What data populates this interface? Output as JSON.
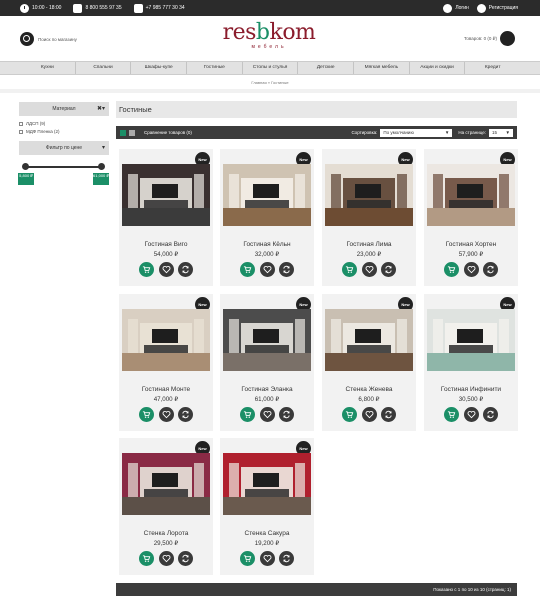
{
  "topbar": {
    "hours": "10:00 - 18:00",
    "phone1": "8 800 555 97 35",
    "phone2": "+7 985 777 30 34",
    "login": "Логин",
    "register": "Регистрация"
  },
  "header": {
    "search_placeholder": "Поиск по магазину",
    "logo_prefix": "res",
    "logo_mid": "b",
    "logo_suffix": "kom",
    "logo_sub": "мебель",
    "cart_text": "Товаров: 0 (0 ₽)"
  },
  "nav": [
    "Кухни",
    "Спальни",
    "Шкафы-купе",
    "Гостиные",
    "Столы и стулья",
    "Детские",
    "Мягкая мебель",
    "Акции и скидки",
    "Кредит"
  ],
  "breadcrumb": "Главная » Гостиные",
  "sidebar": {
    "material_title": "Материал",
    "options": [
      "ЛДСП (9)",
      "МДФ Пленка (2)"
    ],
    "price_filter_title": "Фильтр по цене",
    "price_min": "5,800 ₽",
    "price_max": "61,000 ₽"
  },
  "main": {
    "title": "Гостиные",
    "compare": "Сравнение товаров (0)",
    "sort_label": "Сортировка:",
    "sort_value": "По умолчанию",
    "per_page_label": "На странице:",
    "per_page_value": "15",
    "badge_text": "New",
    "pagination": "Показано с 1 по 10 из 10 (страниц: 1)"
  },
  "products": [
    {
      "name": "Гостиная Виго",
      "price": "54,000 ₽",
      "wall": "#3a3030",
      "floor": "#3b3b3b",
      "accent": "#e8e4de"
    },
    {
      "name": "Гостиная Кёльн",
      "price": "32,000 ₽",
      "wall": "#cfc3b2",
      "floor": "#8a6a4b",
      "accent": "#f4efe8"
    },
    {
      "name": "Гостиная Лима",
      "price": "23,000 ₽",
      "wall": "#e4ddd3",
      "floor": "#6d4c33",
      "accent": "#5a4030"
    },
    {
      "name": "Гостиная Хортен",
      "price": "57,900 ₽",
      "wall": "#ece7e2",
      "floor": "#b29a84",
      "accent": "#6b4a3b"
    },
    {
      "name": "Гостиная Монте",
      "price": "47,000 ₽",
      "wall": "#d9cfc2",
      "floor": "#a98e74",
      "accent": "#e9e2d6"
    },
    {
      "name": "Гостиная Эланка",
      "price": "61,000 ₽",
      "wall": "#4c4c4c",
      "floor": "#7a7068",
      "accent": "#e8e6e0"
    },
    {
      "name": "Стенка Женева",
      "price": "6,800 ₽",
      "wall": "#c9bfb2",
      "floor": "#6e5440",
      "accent": "#f0ece6"
    },
    {
      "name": "Гостиная Инфинити",
      "price": "30,500 ₽",
      "wall": "#dfe3e0",
      "floor": "#8fb6a9",
      "accent": "#f4f2ee"
    },
    {
      "name": "Стенка Лорота",
      "price": "29,500 ₽",
      "wall": "#8a2a45",
      "floor": "#5c5048",
      "accent": "#e8e4dc"
    },
    {
      "name": "Стенка Сакура",
      "price": "19,200 ₽",
      "wall": "#b0202e",
      "floor": "#6a5a4e",
      "accent": "#efebe4"
    }
  ],
  "colors": {
    "accent": "#1b8f67",
    "brand": "#8b1c2c",
    "dark": "#3c3c3c"
  }
}
